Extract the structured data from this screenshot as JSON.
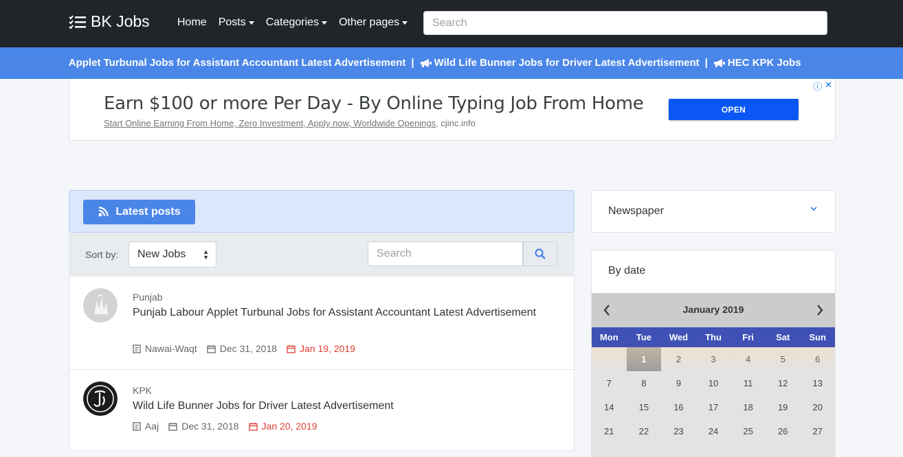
{
  "navbar": {
    "brand": "BK Jobs",
    "links": [
      {
        "label": "Home",
        "dropdown": false
      },
      {
        "label": "Posts",
        "dropdown": true
      },
      {
        "label": "Categories",
        "dropdown": true
      },
      {
        "label": "Other pages",
        "dropdown": true
      }
    ],
    "search_placeholder": "Search"
  },
  "ticker": {
    "items": [
      "our Applet Turbunal Jobs for Assistant Accountant Latest Advertisement",
      "Wild Life Bunner Jobs for Driver Latest Advertisement",
      "HEC KPK Jobs"
    ],
    "separator": "|"
  },
  "ad": {
    "title": "Earn $100 or more Per Day - By Online Typing Job From Home",
    "subtitle_link": "Start Online Earning From Home, Zero Investment, Apply now, Worldwide Openings",
    "subtitle_domain": ", cjinc.info",
    "button": "OPEN",
    "info": "ⓘ",
    "close": "✕"
  },
  "posts": {
    "header_button": "Latest posts",
    "sort_label": "Sort by:",
    "sort_value": "New Jobs",
    "search_placeholder": "Search",
    "items": [
      {
        "region": "Punjab",
        "title": "Punjab Labour Applet Turbunal Jobs for Assistant Accountant Latest Advertisement",
        "newspaper": "Nawai-Waqt",
        "posted": "Dec 31, 2018",
        "deadline": "Jan 19, 2019"
      },
      {
        "region": "KPK",
        "title": "Wild Life Bunner Jobs for Driver Latest Advertisement",
        "newspaper": "Aaj",
        "posted": "Dec 31, 2018",
        "deadline": "Jan 20, 2019"
      }
    ]
  },
  "sidebar": {
    "newspaper_label": "Newspaper",
    "by_date_label": "By date",
    "calendar": {
      "month": "January 2019",
      "days": [
        "Mon",
        "Tue",
        "Wed",
        "Thu",
        "Fri",
        "Sat",
        "Sun"
      ],
      "weeks": [
        [
          "",
          "1",
          "2",
          "3",
          "4",
          "5",
          "6"
        ],
        [
          "7",
          "8",
          "9",
          "10",
          "11",
          "12",
          "13"
        ],
        [
          "14",
          "15",
          "16",
          "17",
          "18",
          "19",
          "20"
        ],
        [
          "21",
          "22",
          "23",
          "24",
          "25",
          "26",
          "27"
        ]
      ],
      "selected": "1"
    }
  },
  "colors": {
    "navbar_bg": "#212529",
    "ticker_bg": "#4a86e8",
    "accent": "#4a86e8",
    "deadline_red": "#e03c31",
    "calendar_days_bg": "#3f51b5"
  }
}
